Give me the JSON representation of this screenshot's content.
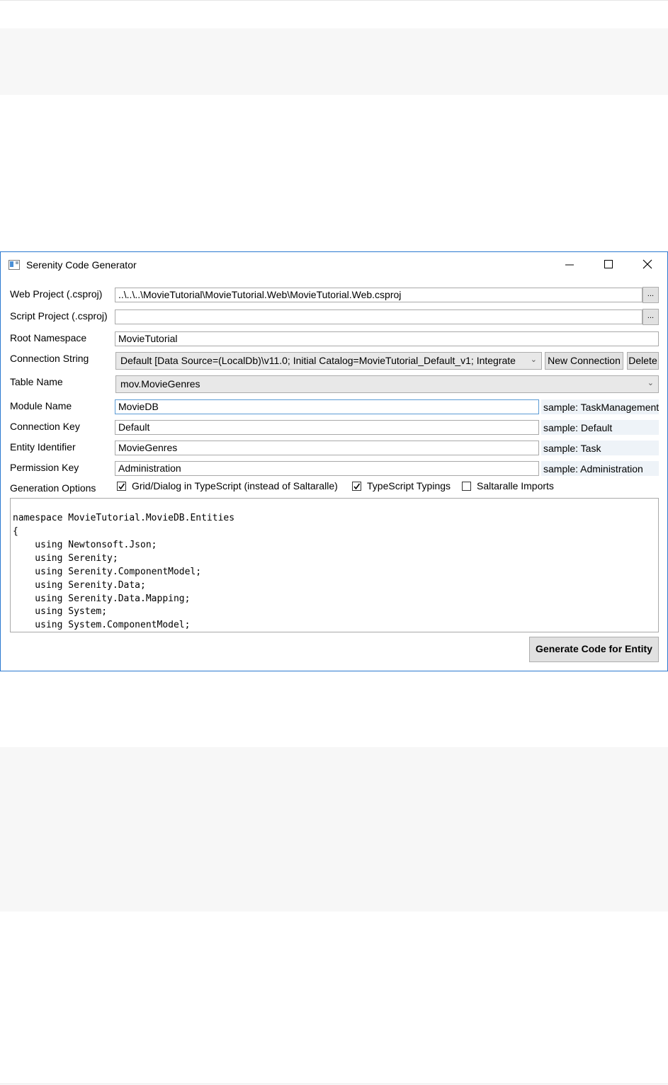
{
  "window": {
    "title": "Serenity Code Generator"
  },
  "form": {
    "web_project": {
      "label": "Web Project (.csproj)",
      "value": "..\\..\\..\\MovieTutorial\\MovieTutorial.Web\\MovieTutorial.Web.csproj",
      "browse_label": "..."
    },
    "script_project": {
      "label": "Script Project (.csproj)",
      "value": "",
      "browse_label": "..."
    },
    "root_namespace": {
      "label": "Root Namespace",
      "value": "MovieTutorial"
    },
    "connection_string": {
      "label": "Connection String",
      "value": "Default [Data Source=(LocalDb)\\v11.0; Initial Catalog=MovieTutorial_Default_v1; Integrate",
      "new_button": "New Connection",
      "delete_button": "Delete"
    },
    "table_name": {
      "label": "Table Name",
      "value": "mov.MovieGenres"
    },
    "module_name": {
      "label": "Module Name",
      "value": "MovieDB",
      "sample": "sample: TaskManagement"
    },
    "connection_key": {
      "label": "Connection Key",
      "value": "Default",
      "sample": "sample: Default"
    },
    "entity_identifier": {
      "label": "Entity Identifier",
      "value": "MovieGenres",
      "sample": "sample: Task"
    },
    "permission_key": {
      "label": "Permission Key",
      "value": "Administration",
      "sample": "sample: Administration"
    },
    "generation_options": {
      "label": "Generation Options",
      "options": [
        {
          "label": "Grid/Dialog in TypeScript (instead of Saltaralle)",
          "checked": true
        },
        {
          "label": "TypeScript Typings",
          "checked": true
        },
        {
          "label": "Saltaralle Imports",
          "checked": false
        }
      ]
    }
  },
  "code": {
    "lines": [
      "namespace MovieTutorial.MovieDB.Entities",
      "{",
      "    using Newtonsoft.Json;",
      "    using Serenity;",
      "    using Serenity.ComponentModel;",
      "    using Serenity.Data;",
      "    using Serenity.Data.Mapping;",
      "    using System;",
      "    using System.ComponentModel;"
    ]
  },
  "generate_button": "Generate Code for Entity",
  "colors": {
    "window_border": "#2b79d0",
    "button_bg": "#e1e1e1",
    "sample_bg": "#eef3f8"
  }
}
